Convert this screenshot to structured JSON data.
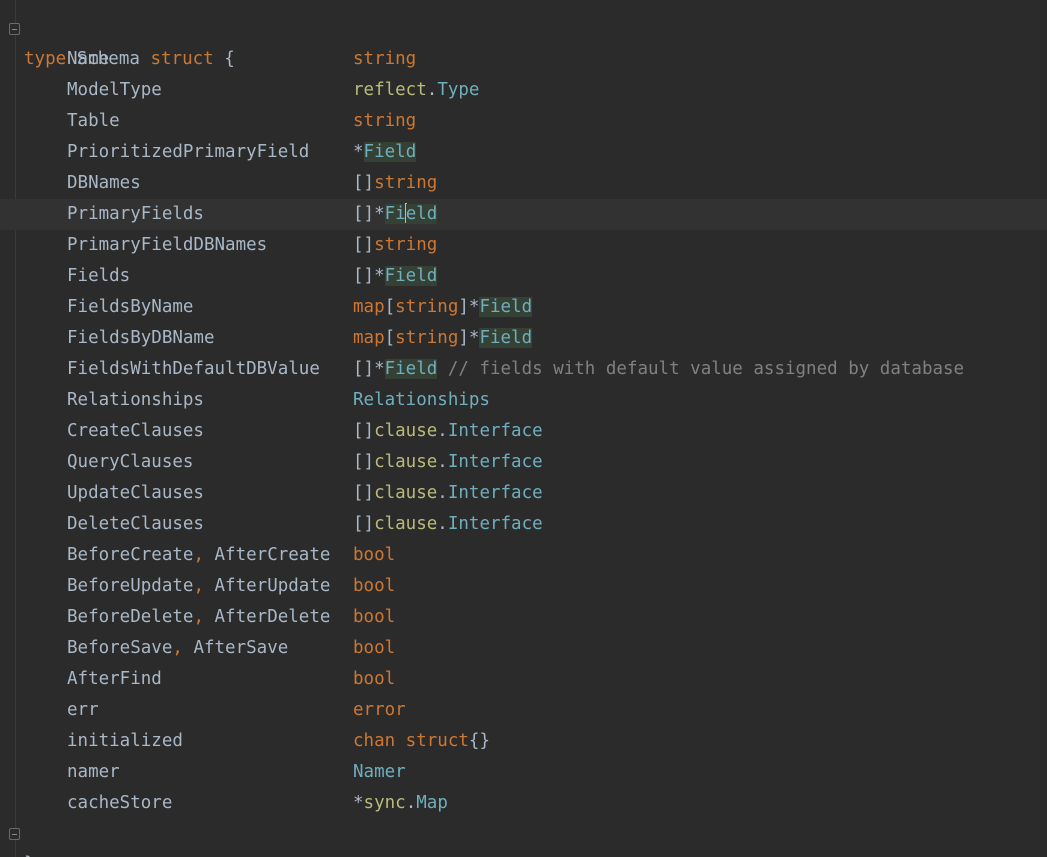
{
  "struct_decl": {
    "keyword_type": "type",
    "name": "Schema",
    "keyword_struct": "struct",
    "open_brace": "{",
    "close_brace": "}"
  },
  "fields": [
    {
      "name": "Name",
      "type": [
        [
          "kw",
          "string"
        ]
      ]
    },
    {
      "name": "ModelType",
      "type": [
        [
          "pkg",
          "reflect"
        ],
        [
          "op",
          "."
        ],
        [
          "type-ref",
          "Type"
        ]
      ]
    },
    {
      "name": "Table",
      "type": [
        [
          "kw",
          "string"
        ]
      ]
    },
    {
      "name": "PrioritizedPrimaryField",
      "type": [
        [
          "op",
          "*"
        ],
        [
          "type-ref hl",
          "Field"
        ]
      ]
    },
    {
      "name": "DBNames",
      "type": [
        [
          "op",
          "[]"
        ],
        [
          "kw",
          "string"
        ]
      ]
    },
    {
      "name": "PrimaryFields",
      "type": [
        [
          "op",
          "[]*"
        ],
        [
          "type-ref hl",
          "Fi"
        ],
        [
          "caret",
          ""
        ],
        [
          "type-ref hl",
          "eld"
        ]
      ],
      "caret_row": true
    },
    {
      "name": "PrimaryFieldDBNames",
      "type": [
        [
          "op",
          "[]"
        ],
        [
          "kw",
          "string"
        ]
      ]
    },
    {
      "name": "Fields",
      "type": [
        [
          "op",
          "[]*"
        ],
        [
          "type-ref hl",
          "Field"
        ]
      ]
    },
    {
      "name": "FieldsByName",
      "type": [
        [
          "kw",
          "map"
        ],
        [
          "op",
          "["
        ],
        [
          "kw",
          "string"
        ],
        [
          "op",
          "]*"
        ],
        [
          "type-ref hl",
          "Field"
        ]
      ]
    },
    {
      "name": "FieldsByDBName",
      "type": [
        [
          "kw",
          "map"
        ],
        [
          "op",
          "["
        ],
        [
          "kw",
          "string"
        ],
        [
          "op",
          "]*"
        ],
        [
          "type-ref hl",
          "Field"
        ]
      ]
    },
    {
      "name": "FieldsWithDefaultDBValue",
      "type": [
        [
          "op",
          "[]*"
        ],
        [
          "type-ref hl",
          "Field"
        ],
        [
          "comment",
          " // fields with default value assigned by database"
        ]
      ]
    },
    {
      "name": "Relationships",
      "type": [
        [
          "type-ref",
          "Relationships"
        ]
      ]
    },
    {
      "name": "CreateClauses",
      "type": [
        [
          "op",
          "[]"
        ],
        [
          "pkg",
          "clause"
        ],
        [
          "op",
          "."
        ],
        [
          "type-ref",
          "Interface"
        ]
      ]
    },
    {
      "name": "QueryClauses",
      "type": [
        [
          "op",
          "[]"
        ],
        [
          "pkg",
          "clause"
        ],
        [
          "op",
          "."
        ],
        [
          "type-ref",
          "Interface"
        ]
      ]
    },
    {
      "name": "UpdateClauses",
      "type": [
        [
          "op",
          "[]"
        ],
        [
          "pkg",
          "clause"
        ],
        [
          "op",
          "."
        ],
        [
          "type-ref",
          "Interface"
        ]
      ]
    },
    {
      "name": "DeleteClauses",
      "type": [
        [
          "op",
          "[]"
        ],
        [
          "pkg",
          "clause"
        ],
        [
          "op",
          "."
        ],
        [
          "type-ref",
          "Interface"
        ]
      ]
    },
    {
      "name": [
        "BeforeCreate",
        "AfterCreate"
      ],
      "type": [
        [
          "kw",
          "bool"
        ]
      ]
    },
    {
      "name": [
        "BeforeUpdate",
        "AfterUpdate"
      ],
      "type": [
        [
          "kw",
          "bool"
        ]
      ]
    },
    {
      "name": [
        "BeforeDelete",
        "AfterDelete"
      ],
      "type": [
        [
          "kw",
          "bool"
        ]
      ]
    },
    {
      "name": [
        "BeforeSave",
        "AfterSave"
      ],
      "type": [
        [
          "kw",
          "bool"
        ]
      ]
    },
    {
      "name": "AfterFind",
      "type": [
        [
          "kw",
          "bool"
        ]
      ]
    },
    {
      "name": "err",
      "type": [
        [
          "kw",
          "error"
        ]
      ]
    },
    {
      "name": "initialized",
      "type": [
        [
          "kw",
          "chan struct"
        ],
        [
          "op",
          "{}"
        ]
      ]
    },
    {
      "name": "namer",
      "type": [
        [
          "type-ref",
          "Namer"
        ]
      ]
    },
    {
      "name": "cacheStore",
      "type": [
        [
          "op",
          "*"
        ],
        [
          "pkg",
          "sync"
        ],
        [
          "op",
          "."
        ],
        [
          "type-ref",
          "Map"
        ]
      ]
    }
  ],
  "colors": {
    "background": "#2b2b2b",
    "keyword": "#cc7832",
    "type_ref": "#6fafbd",
    "package": "#b9bb7a",
    "text": "#a9b7c6",
    "comment": "#808080",
    "highlight": "#344134",
    "caret_row": "#323232"
  }
}
